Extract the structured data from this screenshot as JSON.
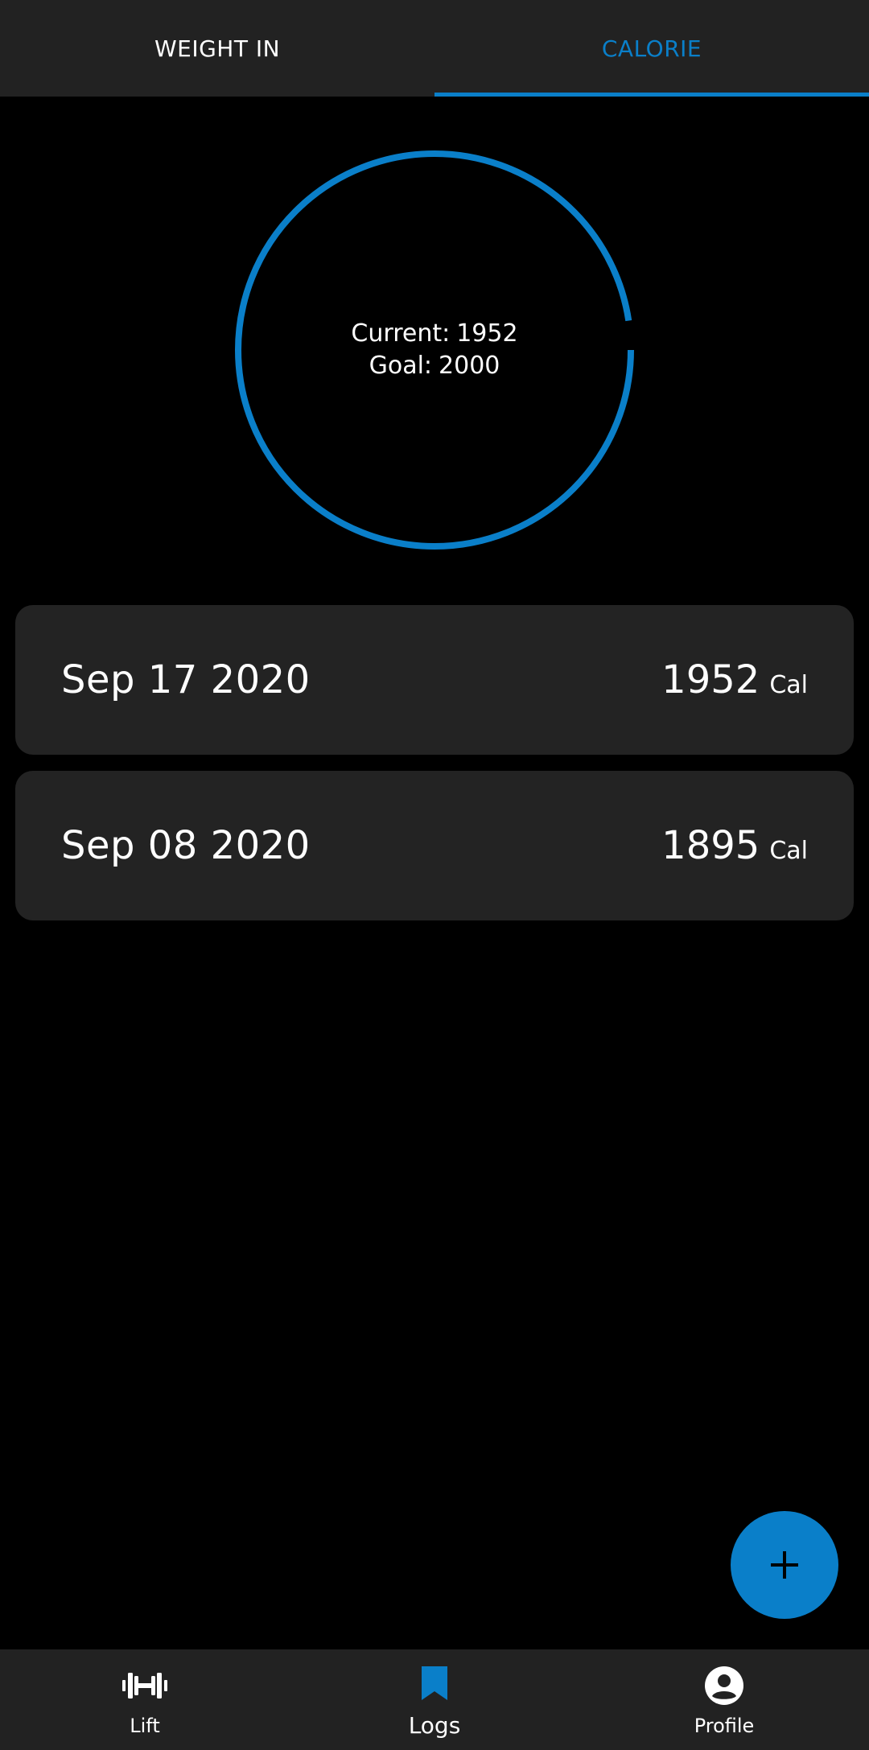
{
  "tabs": [
    {
      "label": "WEIGHT IN",
      "active": false
    },
    {
      "label": "CALORIE",
      "active": true
    }
  ],
  "progress": {
    "current_label": "Current:",
    "current_value": "1952",
    "goal_label": "Goal:",
    "goal_value": "2000",
    "fraction": 0.976
  },
  "logs": [
    {
      "date": "Sep 17 2020",
      "value": "1952",
      "unit": "Cal"
    },
    {
      "date": "Sep 08 2020",
      "value": "1895",
      "unit": "Cal"
    }
  ],
  "fab": {
    "icon": "plus-icon"
  },
  "bottom_nav": [
    {
      "label": "Lift",
      "icon": "dumbbell-icon",
      "active": false
    },
    {
      "label": "Logs",
      "icon": "bookmark-icon",
      "active": true
    },
    {
      "label": "Profile",
      "icon": "account-circle-icon",
      "active": false
    }
  ],
  "colors": {
    "accent": "#0a7fc9",
    "surface": "#222222",
    "background": "#000000",
    "text": "#ffffff"
  }
}
